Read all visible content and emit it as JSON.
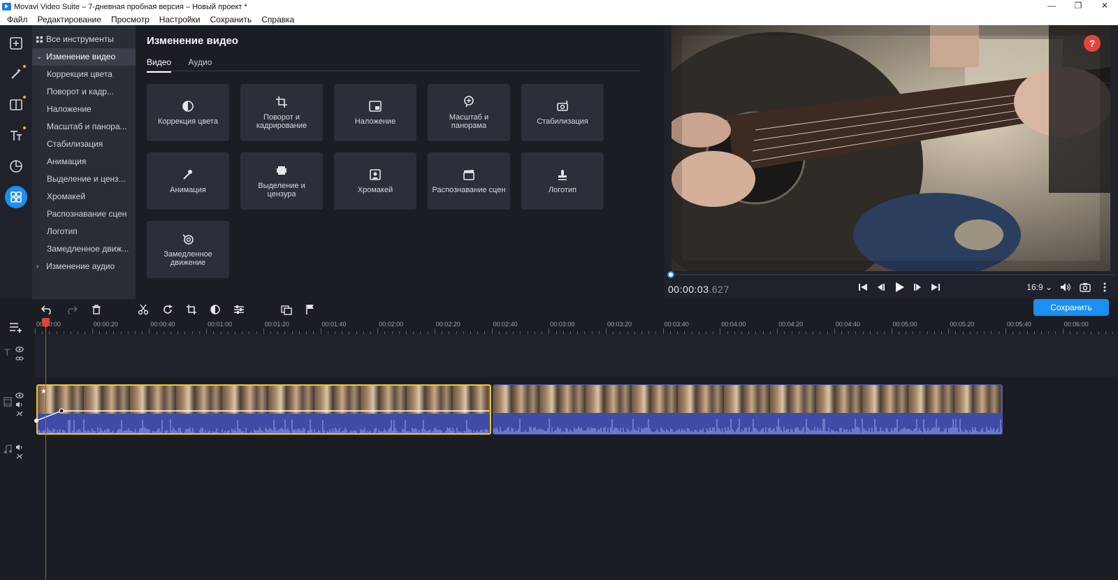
{
  "window": {
    "title": "Movavi Video Suite – 7-дневная пробная версия – Новый проект *",
    "controls": [
      "minimize-icon",
      "maximize-icon",
      "close-icon"
    ]
  },
  "menu": [
    "Файл",
    "Редактирование",
    "Просмотр",
    "Настройки",
    "Сохранить",
    "Справка"
  ],
  "rail": {
    "items": [
      "import-icon",
      "magic-wand-icon",
      "transitions-icon",
      "titles-icon",
      "stickers-icon",
      "more-tools-icon"
    ],
    "active_index": 5,
    "colors": {
      "active": "#1c8ff0",
      "badge": "#f6b51e"
    }
  },
  "tools": {
    "all_tools": "Все инструменты",
    "video_section": "Изменение видео",
    "items": [
      "Коррекция цвета",
      "Поворот и кадр...",
      "Наложение",
      "Масштаб и панора...",
      "Стабилизация",
      "Анимация",
      "Выделение и ценз...",
      "Хромакей",
      "Распознавание сцен",
      "Логотип",
      "Замедленное движ..."
    ],
    "audio_section": "Изменение аудио"
  },
  "panel": {
    "title": "Изменение видео",
    "tabs": [
      "Видео",
      "Аудио"
    ],
    "active_tab": 0,
    "cards": [
      {
        "label": "Коррекция цвета",
        "icon": "color-correction-icon"
      },
      {
        "label": "Поворот и кадрирование",
        "icon": "rotate-crop-icon"
      },
      {
        "label": "Наложение",
        "icon": "overlay-icon"
      },
      {
        "label": "Масштаб и панорама",
        "icon": "zoom-pan-icon"
      },
      {
        "label": "Стабилизация",
        "icon": "stabilization-icon"
      },
      {
        "label": "Анимация",
        "icon": "animation-icon"
      },
      {
        "label": "Выделение и цензура",
        "icon": "highlight-censor-icon"
      },
      {
        "label": "Хромакей",
        "icon": "chroma-key-icon"
      },
      {
        "label": "Распознавание сцен",
        "icon": "scene-detection-icon"
      },
      {
        "label": "Логотип",
        "icon": "logo-icon"
      },
      {
        "label": "Замедленное движение",
        "icon": "slow-motion-icon"
      }
    ]
  },
  "player": {
    "help": "?",
    "timecode_main": "00:00:03",
    "timecode_ms": ".627",
    "aspect": "16:9",
    "progress": 0.0
  },
  "timeline": {
    "save_label": "Сохранить",
    "ruler": [
      "00:00:00",
      "00:00:20",
      "00:00:40",
      "00:01:00",
      "00:01:20",
      "00:01:40",
      "00:02:00",
      "00:02:20",
      "00:02:40",
      "00:03:00",
      "00:03:20",
      "00:03:40",
      "00:04:00",
      "00:04:20",
      "00:04:40",
      "00:05:00",
      "00:05:20",
      "00:05:40",
      "00:06:00"
    ],
    "toolbar": [
      "undo-icon",
      "redo-icon",
      "delete-icon",
      "cut-icon",
      "rotate-icon",
      "crop-icon",
      "color-adjust-icon",
      "clip-properties-icon",
      "overlay-tool-icon",
      "marker-icon"
    ]
  }
}
